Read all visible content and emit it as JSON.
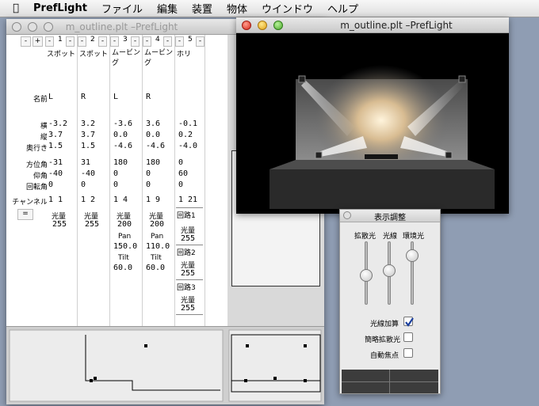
{
  "menubar": {
    "app": "PrefLight",
    "items": [
      "ファイル",
      "編集",
      "装置",
      "物体",
      "ウインドウ",
      "ヘルプ"
    ]
  },
  "outline_window": {
    "title": "m_outline.plt –PrefLight"
  },
  "stage_window": {
    "title": "m_outline.plt –PrefLight"
  },
  "grid": {
    "row_labels": {
      "name": "名前",
      "x": "横",
      "y": "縦",
      "z": "奥行き",
      "azimuth": "方位角",
      "elevation": "仰角",
      "rotation": "回転角",
      "channel": "チャンネル"
    },
    "equals_button": "=",
    "add_button": "+",
    "remove_button": "-",
    "columns": [
      {
        "num": "1",
        "type": "スポット",
        "name": "L",
        "x": "-3.2",
        "y": "3.7",
        "z": "1.5",
        "az": "-31",
        "el": "-40",
        "rot": "0",
        "ch_a": "1",
        "ch_b": "1",
        "params": [
          {
            "label": "光量",
            "value": "255"
          }
        ]
      },
      {
        "num": "2",
        "type": "スポット",
        "name": "R",
        "x": "3.2",
        "y": "3.7",
        "z": "1.5",
        "az": "31",
        "el": "-40",
        "rot": "0",
        "ch_a": "1",
        "ch_b": "2",
        "params": [
          {
            "label": "光量",
            "value": "255"
          }
        ]
      },
      {
        "num": "3",
        "type": "ムービング",
        "name": "L",
        "x": "-3.6",
        "y": "0.0",
        "z": "-4.6",
        "az": "180",
        "el": "0",
        "rot": "0",
        "ch_a": "1",
        "ch_b": "4",
        "params": [
          {
            "label": "光量",
            "value": "200"
          },
          {
            "label": "Pan",
            "value": "150.0"
          },
          {
            "label": "Tilt",
            "value": "60.0"
          }
        ]
      },
      {
        "num": "4",
        "type": "ムービング",
        "name": "R",
        "x": "3.6",
        "y": "0.0",
        "z": "-4.6",
        "az": "180",
        "el": "0",
        "rot": "0",
        "ch_a": "1",
        "ch_b": "9",
        "params": [
          {
            "label": "光量",
            "value": "200"
          },
          {
            "label": "Pan",
            "value": "110.0"
          },
          {
            "label": "Tilt",
            "value": "60.0"
          }
        ]
      },
      {
        "num": "5",
        "type": "ホリ",
        "name": "",
        "x": "-0.1",
        "y": "0.2",
        "z": "-4.0",
        "az": "0",
        "el": "60",
        "rot": "0",
        "ch_a": "1",
        "ch_b": "21",
        "circuits": [
          {
            "label": "回路1",
            "sub": "光量",
            "value": "255"
          },
          {
            "label": "回路2",
            "sub": "光量",
            "value": "255"
          },
          {
            "label": "回路3",
            "sub": "光量",
            "value": "255"
          }
        ]
      }
    ]
  },
  "display_panel": {
    "title": "表示調整",
    "slider_labels": [
      "拡散光",
      "光線",
      "環境光"
    ],
    "slider_levels": [
      0.55,
      0.45,
      0.15
    ],
    "checks": [
      {
        "label": "光線加算",
        "checked": true
      },
      {
        "label": "簡略拡散光",
        "checked": false
      },
      {
        "label": "自動焦点",
        "checked": false
      }
    ]
  }
}
